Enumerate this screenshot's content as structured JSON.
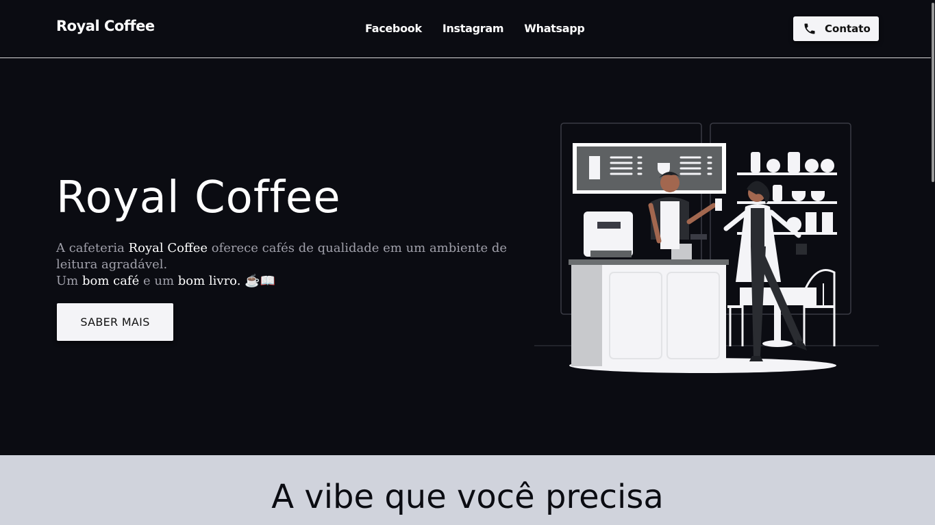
{
  "header": {
    "brand": "Royal Coffee",
    "nav": [
      "Facebook",
      "Instagram",
      "Whatsapp"
    ],
    "contact_label": "Contato"
  },
  "hero": {
    "title": "Royal Coffee",
    "text_parts": {
      "p1": "A cafeteria ",
      "p2": "Royal Coffee",
      "p3": " oferece cafés de qualidade em um ambiente de leitura agradável.",
      "p4": "Um ",
      "p5": "bom café",
      "p6": " e um ",
      "p7": "bom livro.",
      "p8": " ☕📖"
    },
    "cta_label": "SABER MAIS"
  },
  "section2": {
    "title": "A vibe que você precisa"
  },
  "colors": {
    "background": "#0b0c12",
    "accent_button": "#f4f4f7",
    "section_bg": "#d0d3dc"
  },
  "icons": {
    "contact": "phone-icon"
  }
}
